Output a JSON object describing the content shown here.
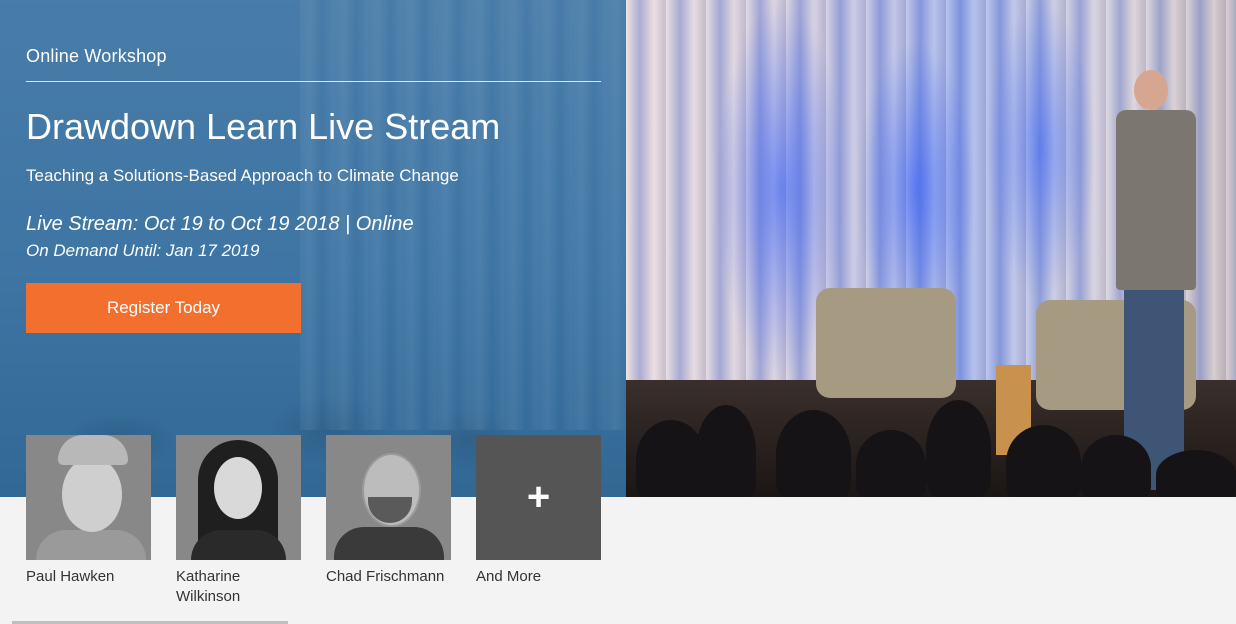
{
  "hero": {
    "eyebrow": "Online Workshop",
    "title": "Drawdown Learn Live Stream",
    "subtitle": "Teaching a Solutions-Based Approach to Climate Change",
    "dates": "Live Stream: Oct 19 to Oct 19 2018 | Online",
    "on_demand": "On Demand Until: Jan 17 2019",
    "register_label": "Register Today"
  },
  "speakers": [
    {
      "name": "Paul Hawken"
    },
    {
      "name": "Katharine Wilkinson"
    },
    {
      "name": "Chad Frischmann"
    }
  ],
  "more": {
    "label": "And More",
    "icon": "plus-icon",
    "glyph": "+"
  },
  "colors": {
    "accent": "#f26f2e",
    "overlay": "#2b6ea0",
    "more_tile": "#555555"
  }
}
